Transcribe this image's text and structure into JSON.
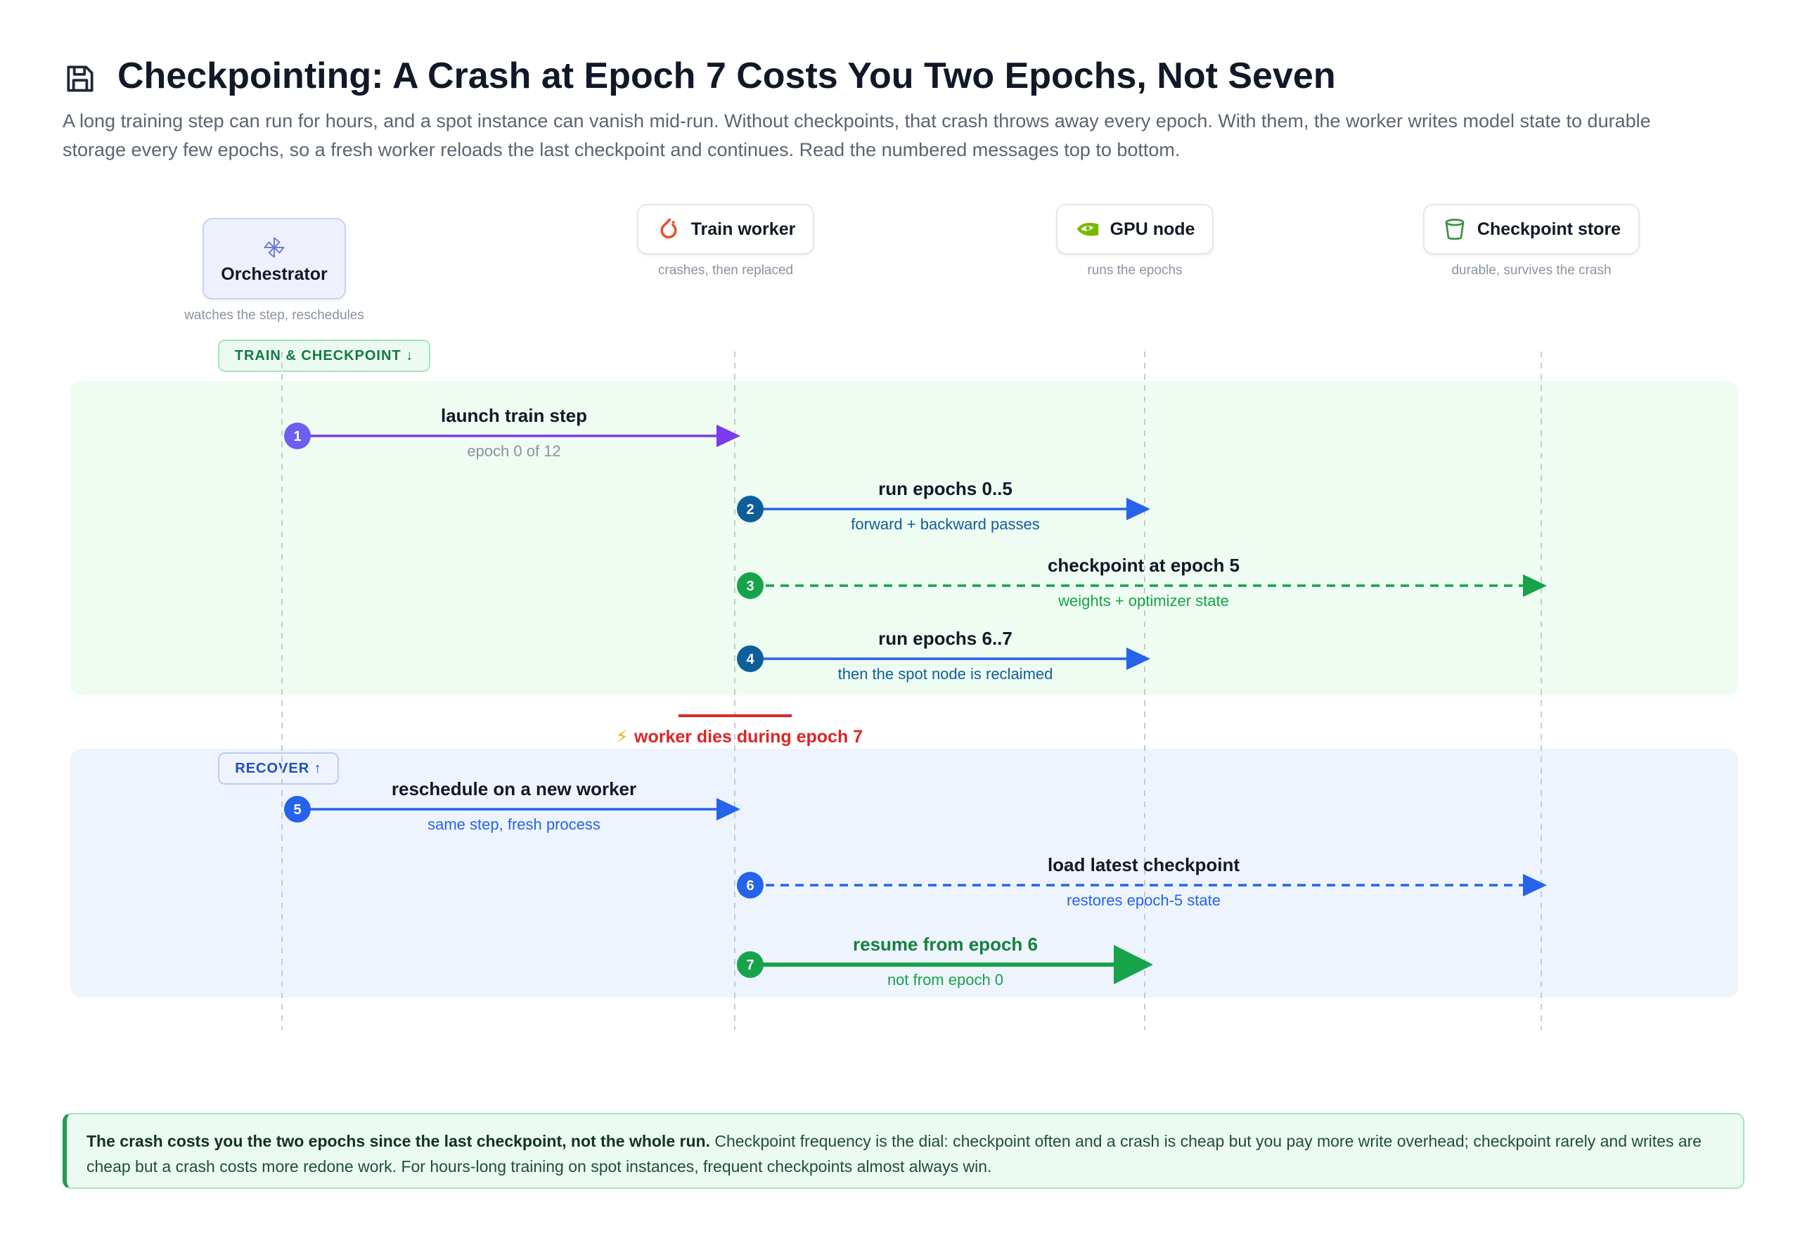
{
  "header": {
    "icon": "save-icon",
    "title": "Checkpointing: A Crash at Epoch 7 Costs You Two Epochs, Not Seven",
    "subtitle": "A long training step can run for hours, and a spot instance can vanish mid-run. Without checkpoints, that crash throws away every epoch. With them, the worker writes model state to durable storage every few epochs, so a fresh worker reloads the last checkpoint and continues. Read the numbered messages top to bottom."
  },
  "actors": [
    {
      "id": "orchestrator",
      "label": "Orchestrator",
      "sub": "watches the step, reschedules",
      "icon": "pinwheel-icon"
    },
    {
      "id": "train",
      "label": "Train worker",
      "sub": "crashes, then replaced",
      "icon": "pytorch-icon"
    },
    {
      "id": "gpu",
      "label": "GPU node",
      "sub": "runs the epochs",
      "icon": "nvidia-icon"
    },
    {
      "id": "store",
      "label": "Checkpoint store",
      "sub": "durable, survives the crash",
      "icon": "bucket-icon"
    }
  ],
  "phases": {
    "train": "TRAIN & CHECKPOINT ↓",
    "recover": "RECOVER ↑"
  },
  "messages": [
    {
      "num": "1",
      "label": "launch train step",
      "sub": "epoch 0 of 12",
      "from": "orchestrator",
      "to": "train",
      "style": "solid",
      "color": "#7c3aed",
      "num_color": "#6d5ef0",
      "label_color": "#111827",
      "sub_color": "#8a93a0"
    },
    {
      "num": "2",
      "label": "run epochs 0..5",
      "sub": "forward + backward passes",
      "from": "train",
      "to": "gpu",
      "style": "solid",
      "color": "#2563eb",
      "num_color": "#0f5e9c",
      "label_color": "#111827",
      "sub_color": "#0f5e9c"
    },
    {
      "num": "3",
      "label": "checkpoint at epoch 5",
      "sub": "weights + optimizer state",
      "from": "train",
      "to": "store",
      "style": "dashed",
      "color": "#16a34a",
      "num_color": "#16a34a",
      "label_color": "#111827",
      "sub_color": "#16a34a"
    },
    {
      "num": "4",
      "label": "run epochs 6..7",
      "sub": "then the spot node is reclaimed",
      "from": "train",
      "to": "gpu",
      "style": "solid",
      "color": "#2563eb",
      "num_color": "#0f5e9c",
      "label_color": "#111827",
      "sub_color": "#0f5e9c"
    },
    {
      "num": "5",
      "label": "reschedule on a new worker",
      "sub": "same step, fresh process",
      "from": "orchestrator",
      "to": "train",
      "style": "solid",
      "color": "#2563eb",
      "num_color": "#2563eb",
      "label_color": "#111827",
      "sub_color": "#2563eb"
    },
    {
      "num": "6",
      "label": "load latest checkpoint",
      "sub": "restores epoch-5 state",
      "from": "train",
      "to": "store",
      "style": "dashed",
      "color": "#2563eb",
      "num_color": "#2563eb",
      "label_color": "#111827",
      "sub_color": "#2563eb"
    },
    {
      "num": "7",
      "label": "resume from epoch 6",
      "sub": "not from epoch 0",
      "from": "train",
      "to": "gpu",
      "style": "thick",
      "color": "#16a34a",
      "num_color": "#16a34a",
      "label_color": "#15803d",
      "sub_color": "#16a34a"
    }
  ],
  "crash": {
    "icon": "lightning-icon",
    "label": "worker dies during epoch 7",
    "color": "#dc2626"
  },
  "callout": {
    "bold": "The crash costs you the two epochs since the last checkpoint, not the whole run.",
    "text": " Checkpoint frequency is the dial: checkpoint often and a crash is cheap but you pay more write overhead; checkpoint rarely and writes are cheap but a crash costs more redone work. For hours-long training on spot instances, frequent checkpoints almost always win."
  }
}
